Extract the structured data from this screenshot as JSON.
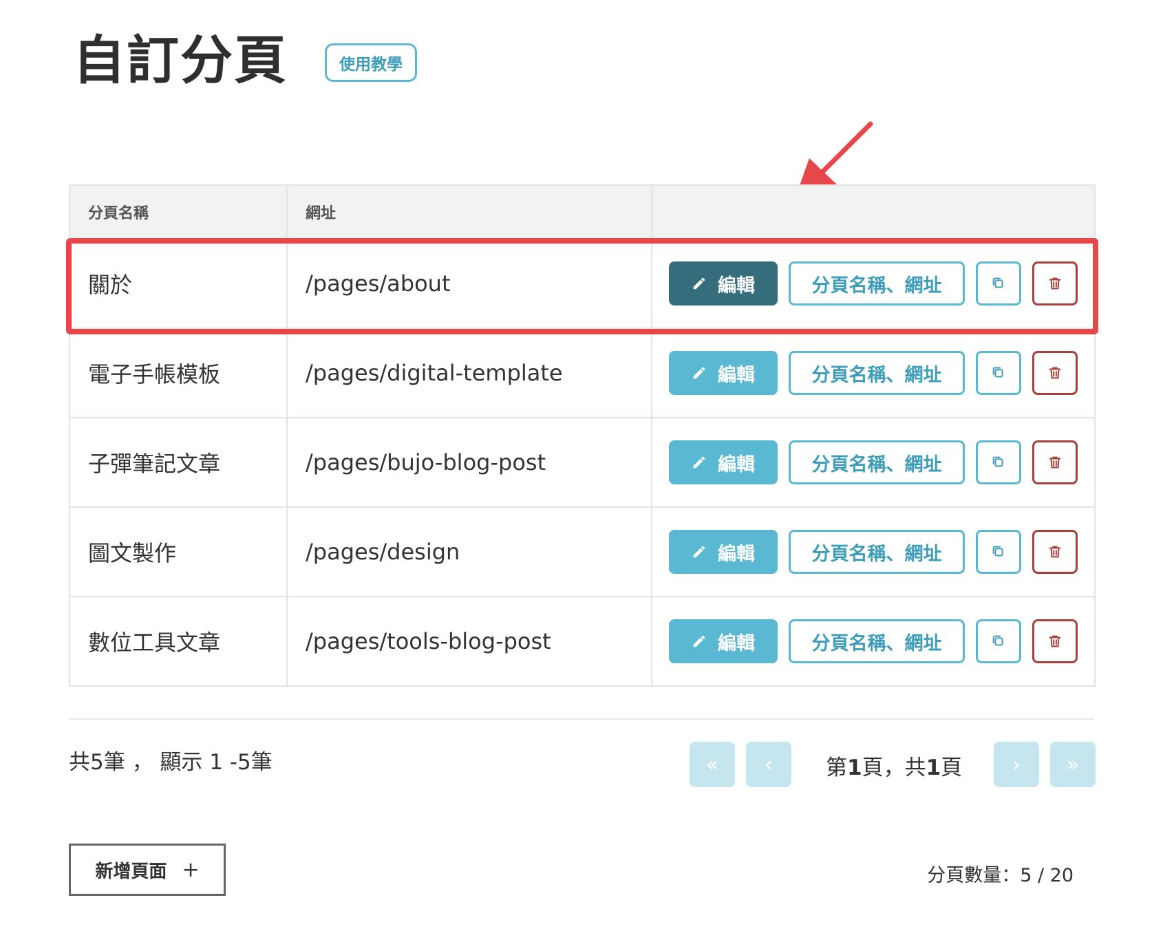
{
  "header": {
    "title": "自訂分頁",
    "tutorial_label": "使用教學"
  },
  "table": {
    "columns": [
      "分頁名稱",
      "網址",
      ""
    ],
    "rows": [
      {
        "name": "關於",
        "url": "/pages/about"
      },
      {
        "name": "電子手帳模板",
        "url": "/pages/digital-template"
      },
      {
        "name": "子彈筆記文章",
        "url": "/pages/bujo-blog-post"
      },
      {
        "name": "圖文製作",
        "url": "/pages/design"
      },
      {
        "name": "數位工具文章",
        "url": "/pages/tools-blog-post"
      }
    ],
    "edit_label": "編輯",
    "rename_label": "分頁名稱、網址"
  },
  "pagination": {
    "summary": "共5筆 ， 顯示 1 -5筆",
    "first": "«",
    "prev": "‹",
    "next": "›",
    "last": "»",
    "page_prefix": "第",
    "current_page": "1",
    "page_middle": "頁，共",
    "total_pages": "1",
    "page_suffix": "頁"
  },
  "footer": {
    "add_label": "新增頁面",
    "add_icon": "+",
    "page_count": "分頁數量：5 / 20"
  },
  "colors": {
    "accent": "#5ab8d3",
    "edit_active": "#356d7c",
    "danger": "#a6403c",
    "highlight": "#e5474b"
  }
}
